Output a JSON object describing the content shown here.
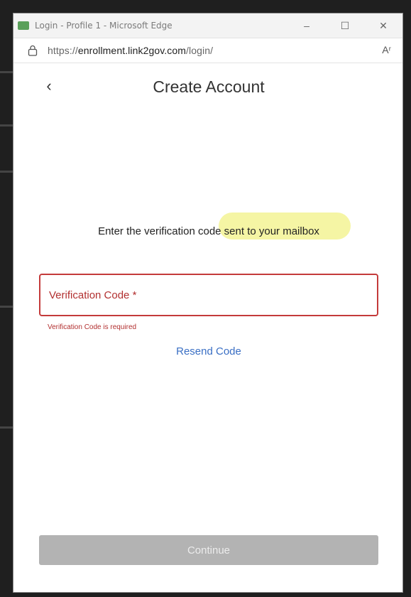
{
  "window": {
    "title": "Login - Profile 1 - Microsoft Edge",
    "controls": {
      "minimize_glyph": "–",
      "maximize_glyph": "☐",
      "close_glyph": "✕"
    }
  },
  "address_bar": {
    "url_prefix": "https://",
    "url_host": "enrollment.link2gov.com",
    "url_path": "/login/",
    "reader_glyph": "Aʳ",
    "lock_icon": "lock-icon"
  },
  "page": {
    "back_glyph": "‹",
    "title": "Create Account",
    "instruction": "Enter the verification code sent to your mailbox",
    "field": {
      "value": "",
      "placeholder": "Verification Code *"
    },
    "error": "Verification Code is required",
    "resend_label": "Resend Code",
    "continue_label": "Continue"
  },
  "colors": {
    "error_red": "#c43b3b",
    "link_blue": "#3a6fc4",
    "disabled_button": "#b3b3b3",
    "highlight_yellow": "#f3f28d"
  }
}
